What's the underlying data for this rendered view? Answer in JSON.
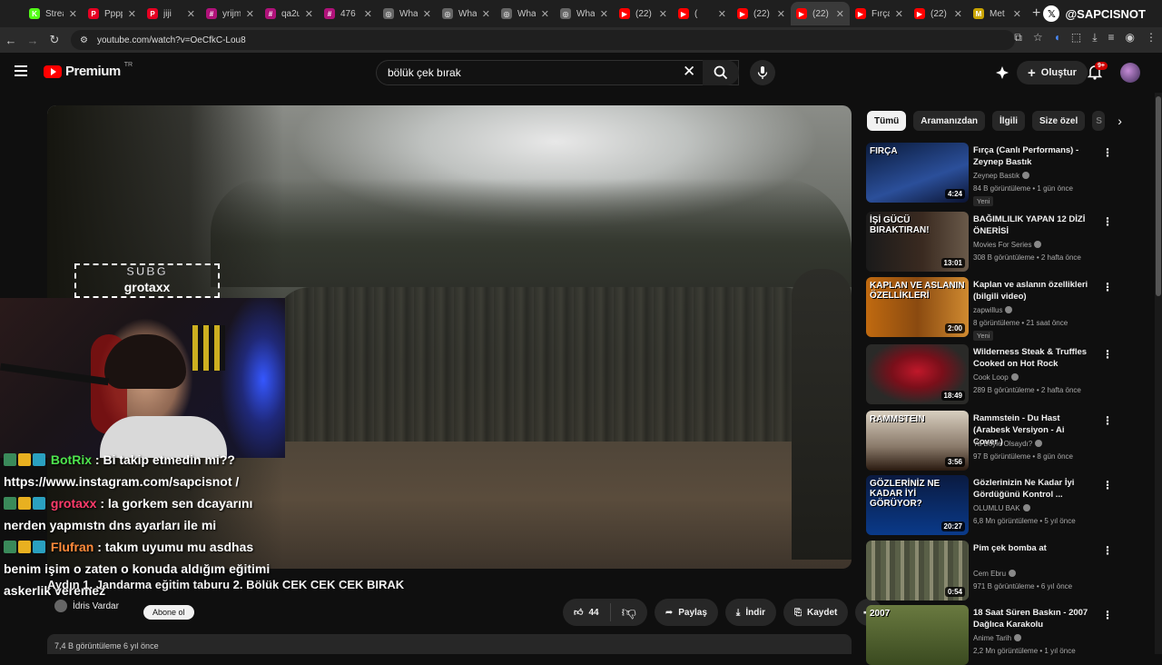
{
  "tabs": [
    {
      "label": "Strea",
      "fav_color": "#53fc18",
      "fav_glyph": "K"
    },
    {
      "label": "Pppp",
      "fav_color": "#e60023",
      "fav_glyph": "P"
    },
    {
      "label": "jiji",
      "fav_color": "#e60023",
      "fav_glyph": "P"
    },
    {
      "label": "yrijm",
      "fav_color": "#b0127a",
      "fav_glyph": "#"
    },
    {
      "label": "qa2u",
      "fav_color": "#b0127a",
      "fav_glyph": "#"
    },
    {
      "label": "476",
      "fav_color": "#b0127a",
      "fav_glyph": "#"
    },
    {
      "label": "Wha",
      "fav_color": "#666666",
      "fav_glyph": "◎"
    },
    {
      "label": "Wha",
      "fav_color": "#666666",
      "fav_glyph": "◎"
    },
    {
      "label": "Wha",
      "fav_color": "#666666",
      "fav_glyph": "◎"
    },
    {
      "label": "Wha",
      "fav_color": "#666666",
      "fav_glyph": "◎"
    },
    {
      "label": "(22)",
      "fav_color": "#ff0000",
      "fav_glyph": "▶"
    },
    {
      "label": "(",
      "fav_color": "#ff0000",
      "fav_glyph": "▶"
    },
    {
      "label": "(22)",
      "fav_color": "#ff0000",
      "fav_glyph": "▶"
    },
    {
      "label": "(22)",
      "fav_color": "#ff0000",
      "fav_glyph": "▶",
      "active": true
    },
    {
      "label": "Fırça",
      "fav_color": "#ff0000",
      "fav_glyph": "▶"
    },
    {
      "label": "(22)",
      "fav_color": "#ff0000",
      "fav_glyph": "▶"
    },
    {
      "label": "Met",
      "fav_color": "#c9a400",
      "fav_glyph": "M"
    }
  ],
  "brand_handle": "@SAPCISNOT",
  "url": "youtube.com/watch?v=OeCfkC-Lou8",
  "yt": {
    "logo_text": "Premium",
    "logo_suffix": "TR",
    "search_value": "bölük çek bırak",
    "create_label": "Oluştur",
    "notif_badge": "9+"
  },
  "overlay": {
    "subg_title": "SUBG",
    "subg_user": "grotaxx"
  },
  "chat": [
    {
      "user": "BotRix",
      "text": ": Bi takip etmedin mi?? https://www.instagram.com/sapcisnot /",
      "color": "#4de34d"
    },
    {
      "user": "grotaxx",
      "text": ": la gorkem sen dcayarını nerden yapmıstn dns ayarları ile mi",
      "color": "#ff3b6b"
    },
    {
      "user": "Flufran",
      "text": ": takım uyumu mu asdhas benim işim o zaten o konuda aldığım eğitimi askerlik veremez",
      "color": "#ff8a3a"
    }
  ],
  "video": {
    "title": "Aydın 1. Jandarma eğitim taburu 2. Bölük CEK CEK CEK BIRAK",
    "channel": "İdris Vardar",
    "subscribe_label": "Abone ol",
    "views_line": "7,4 B görüntüleme  6 yıl önce",
    "likes": "44",
    "share_label": "Paylaş",
    "download_label": "İndir",
    "save_label": "Kaydet"
  },
  "chips": [
    "Tümü",
    "Aramanızdan",
    "İlgili",
    "Size özel",
    "S"
  ],
  "recs": [
    {
      "title": "Fırça (Canlı Performans) - Zeynep Bastık",
      "channel": "Zeynep Bastık",
      "meta": "84 B görüntüleme • 1 gün önce",
      "duration": "4:24",
      "new": "Yeni",
      "thumb_text": "FIRÇA",
      "bg": "linear-gradient(160deg,#0a1a3a,#2b4f9a 60%,#0b1330)"
    },
    {
      "title": "BAĞIMLILIK YAPAN 12 DİZİ ÖNERİSİ",
      "channel": "Movies For Series",
      "meta": "308 B görüntüleme • 2 hafta önce",
      "duration": "13:01",
      "new": "",
      "thumb_text": "İŞİ GÜCÜ BIRAKTIRAN!",
      "bg": "linear-gradient(90deg,#1a1a1a 0%,#3a2a20 55%,#6a5a4a 100%)"
    },
    {
      "title": "Kaplan ve aslanın özellikleri (bilgili video)",
      "channel": "zapwillus",
      "meta": "8 görüntüleme • 21 saat önce",
      "duration": "2:00",
      "new": "Yeni",
      "thumb_text": "KAPLAN VE ASLANIN ÖZELLİKLERİ",
      "bg": "linear-gradient(90deg,#c06a10,#8a4a10 50%,#d08a30)"
    },
    {
      "title": "Wilderness Steak & Truffles Cooked on Hot Rock",
      "channel": "Cook Loop",
      "meta": "289 B görüntüleme • 2 hafta önce",
      "duration": "18:49",
      "new": "",
      "thumb_text": "",
      "bg": "radial-gradient(ellipse at 50% 45%,#c0182a 0%,#7a0f1a 35%,#2a2a28 70%)"
    },
    {
      "title": "Rammstein - Du Hast (Arabesk Versiyon - Ai Cover )",
      "channel": "Ya Boyle Olsaydı?",
      "meta": "97 B görüntüleme • 8 gün önce",
      "duration": "3:56",
      "new": "",
      "thumb_text": "RAMMSTEIN",
      "bg": "linear-gradient(180deg,#d8cfc0,#8a7a6a 60%,#2a1a10)"
    },
    {
      "title": "Gözlerinizin Ne Kadar İyi Gördüğünü Kontrol ...",
      "channel": "OLUMLU BAK",
      "meta": "6,8 Mn görüntüleme • 5 yıl önce",
      "duration": "20:27",
      "new": "",
      "thumb_text": "GÖZLERİNİZ NE KADAR İYİ GÖRÜYOR?",
      "bg": "linear-gradient(180deg,#0a1a40,#0a3a8a)"
    },
    {
      "title": "Pim çek bomba at",
      "channel": "Cem Ebru",
      "meta": "971 B görüntüleme • 6 yıl önce",
      "duration": "0:54",
      "new": "",
      "thumb_text": "",
      "bg": "repeating-linear-gradient(90deg,#5a6048 0 6px,#8a8a70 6px 10px,#4a4e3c 10px 16px)"
    },
    {
      "title": "18 Saat Süren Baskın - 2007 Dağlıca Karakolu",
      "channel": "Anime Tarih",
      "meta": "2,2 Mn görüntüleme • 1 yıl önce",
      "duration": "",
      "new": "",
      "thumb_text": "2007",
      "bg": "linear-gradient(180deg,#6a7a40,#3a4a20)"
    }
  ]
}
